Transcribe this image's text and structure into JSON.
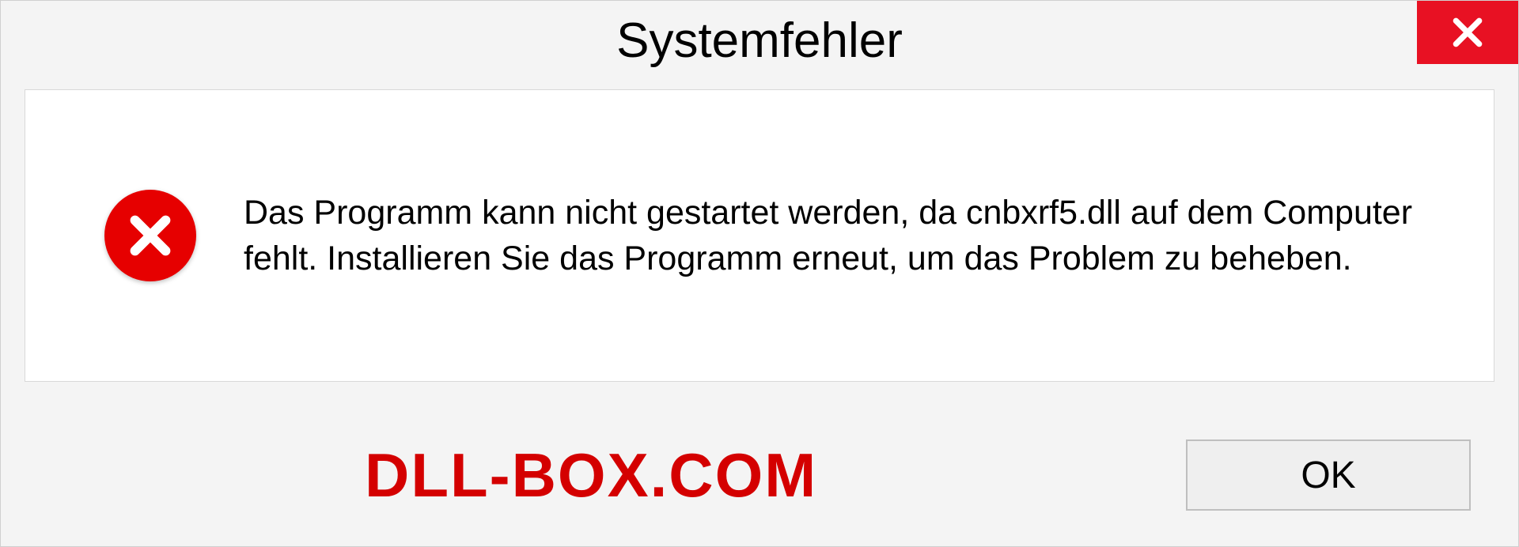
{
  "dialog": {
    "title": "Systemfehler",
    "message": "Das Programm kann nicht gestartet werden, da cnbxrf5.dll auf dem Computer fehlt. Installieren Sie das Programm erneut, um das Problem zu beheben.",
    "ok_label": "OK"
  },
  "watermark": "DLL-BOX.COM"
}
